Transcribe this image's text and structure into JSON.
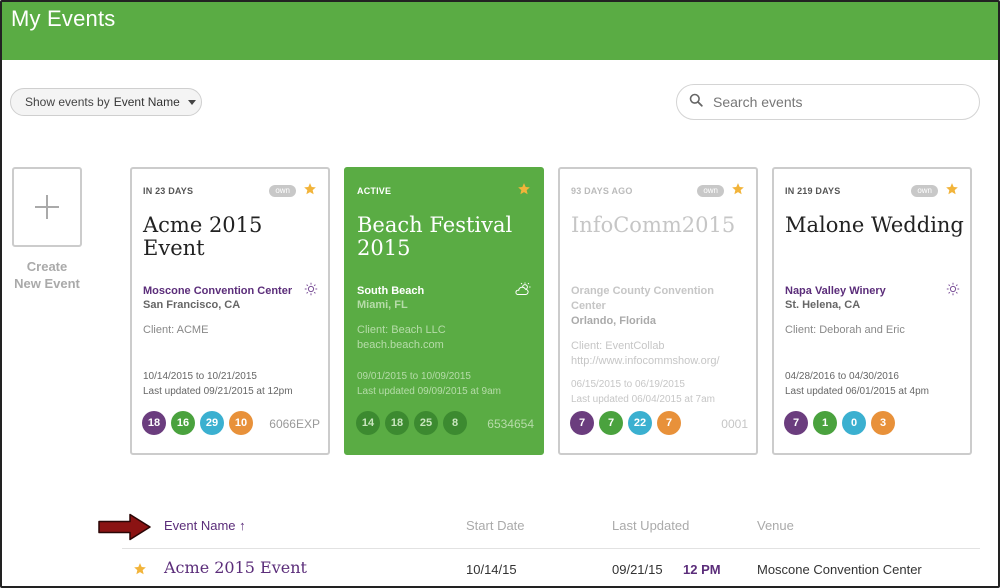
{
  "header": {
    "title": "My Events",
    "accent": "#5aac44"
  },
  "toolbar": {
    "filter_prefix": "Show events by",
    "filter_value": "Event Name",
    "search_placeholder": "Search events"
  },
  "create": {
    "line1": "Create",
    "line2": "New Event"
  },
  "cards": [
    {
      "when": "IN 23 DAYS",
      "own": "own",
      "name": "Acme 2015 Event",
      "venue": "Moscone Convention Center",
      "city": "San Francisco, CA",
      "client": "Client: ACME",
      "client_url": "",
      "dates": "10/14/2015 to 10/21/2015",
      "updated": "Last updated 09/21/2015 at 12pm",
      "badges": [
        "18",
        "16",
        "29",
        "10"
      ],
      "code": "6066EXP",
      "weather_icon": "sun-icon"
    },
    {
      "when": "ACTIVE",
      "own": "",
      "name": "Beach Festival 2015",
      "venue": "South Beach",
      "city": "Miami, FL",
      "client": "Client: Beach LLC",
      "client_url": "beach.beach.com",
      "dates": "09/01/2015 to 10/09/2015",
      "updated": "Last updated 09/09/2015 at 9am",
      "badges": [
        "14",
        "18",
        "25",
        "8"
      ],
      "code": "6534654",
      "weather_icon": "partly-cloudy-icon"
    },
    {
      "when": "93 DAYS AGO",
      "own": "own",
      "name": "InfoComm2015",
      "venue": "Orange County Convention Center",
      "city": "Orlando, Florida",
      "client": "Client: EventCollab",
      "client_url": "http://www.infocommshow.org/",
      "dates": "06/15/2015 to 06/19/2015",
      "updated": "Last updated 06/04/2015 at 7am",
      "badges": [
        "7",
        "7",
        "22",
        "7"
      ],
      "code": "0001",
      "weather_icon": ""
    },
    {
      "when": "IN 219 DAYS",
      "own": "own",
      "name": "Malone Wedding",
      "venue": "Napa Valley Winery",
      "city": "St. Helena, CA",
      "client": "Client: Deborah and Eric",
      "client_url": "",
      "dates": "04/28/2016 to 04/30/2016",
      "updated": "Last updated 06/01/2015 at 4pm",
      "badges": [
        "7",
        "1",
        "0",
        "3"
      ],
      "code": "",
      "weather_icon": "sun-icon"
    }
  ],
  "badge_colors": [
    "#6b3d7e",
    "#4aa23e",
    "#3bb0d0",
    "#e8913a"
  ],
  "list": {
    "columns": {
      "name": "Event Name ↑",
      "start": "Start Date",
      "updated": "Last Updated",
      "venue": "Venue"
    },
    "rows": [
      {
        "name": "Acme 2015 Event",
        "start": "10/14/15",
        "updated_date": "09/21/15",
        "updated_time": "12 PM",
        "venue": "Moscone Convention Center"
      }
    ]
  }
}
